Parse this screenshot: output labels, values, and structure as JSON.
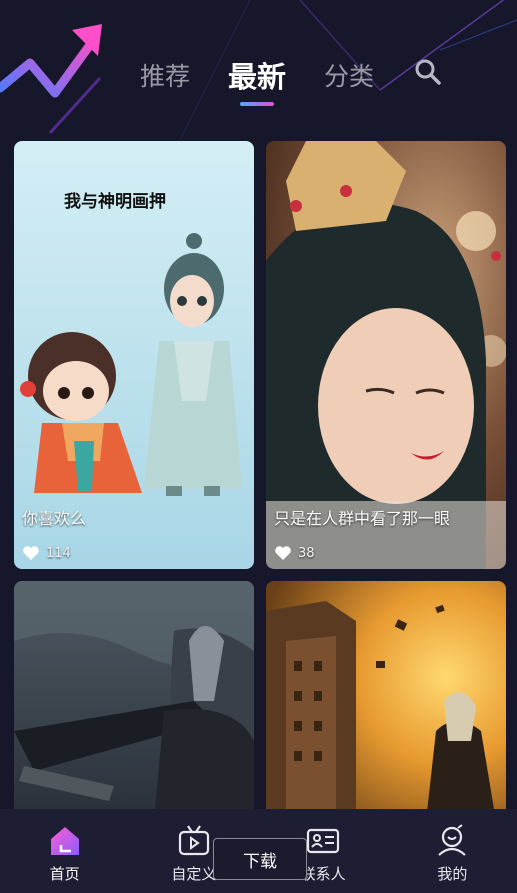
{
  "header": {
    "tabs": [
      {
        "label": "推荐",
        "active": false
      },
      {
        "label": "最新",
        "active": true
      },
      {
        "label": "分类",
        "active": false
      }
    ],
    "search_icon": "search-icon"
  },
  "feed": {
    "cards": [
      {
        "caption": "你喜欢么",
        "likes": "114",
        "art_title": "我与神明画押"
      },
      {
        "caption": "只是在人群中看了那一眼",
        "likes": "38"
      },
      {
        "caption": "",
        "likes": ""
      },
      {
        "caption": "",
        "likes": ""
      }
    ]
  },
  "bottom_nav": {
    "items": [
      {
        "label": "首页",
        "icon": "home-icon",
        "active": true
      },
      {
        "label": "自定义",
        "icon": "tv-icon",
        "active": false
      },
      {
        "label": "联系人",
        "icon": "contact-card-icon",
        "active": false
      },
      {
        "label": "我的",
        "icon": "profile-icon",
        "active": false
      }
    ],
    "download_label": "下载"
  },
  "colors": {
    "background": "#16172a",
    "accent_blue": "#4fa6ff",
    "accent_pink": "#e04fd8"
  }
}
